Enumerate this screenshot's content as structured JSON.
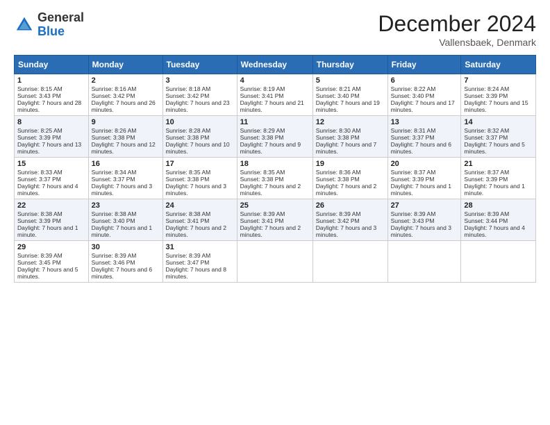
{
  "header": {
    "logo": {
      "general": "General",
      "blue": "Blue"
    },
    "title": "December 2024",
    "location": "Vallensbaek, Denmark"
  },
  "calendar": {
    "days": [
      "Sunday",
      "Monday",
      "Tuesday",
      "Wednesday",
      "Thursday",
      "Friday",
      "Saturday"
    ],
    "weeks": [
      [
        {
          "day": "1",
          "sunrise": "Sunrise: 8:15 AM",
          "sunset": "Sunset: 3:43 PM",
          "daylight": "Daylight: 7 hours and 28 minutes."
        },
        {
          "day": "2",
          "sunrise": "Sunrise: 8:16 AM",
          "sunset": "Sunset: 3:42 PM",
          "daylight": "Daylight: 7 hours and 26 minutes."
        },
        {
          "day": "3",
          "sunrise": "Sunrise: 8:18 AM",
          "sunset": "Sunset: 3:42 PM",
          "daylight": "Daylight: 7 hours and 23 minutes."
        },
        {
          "day": "4",
          "sunrise": "Sunrise: 8:19 AM",
          "sunset": "Sunset: 3:41 PM",
          "daylight": "Daylight: 7 hours and 21 minutes."
        },
        {
          "day": "5",
          "sunrise": "Sunrise: 8:21 AM",
          "sunset": "Sunset: 3:40 PM",
          "daylight": "Daylight: 7 hours and 19 minutes."
        },
        {
          "day": "6",
          "sunrise": "Sunrise: 8:22 AM",
          "sunset": "Sunset: 3:40 PM",
          "daylight": "Daylight: 7 hours and 17 minutes."
        },
        {
          "day": "7",
          "sunrise": "Sunrise: 8:24 AM",
          "sunset": "Sunset: 3:39 PM",
          "daylight": "Daylight: 7 hours and 15 minutes."
        }
      ],
      [
        {
          "day": "8",
          "sunrise": "Sunrise: 8:25 AM",
          "sunset": "Sunset: 3:39 PM",
          "daylight": "Daylight: 7 hours and 13 minutes."
        },
        {
          "day": "9",
          "sunrise": "Sunrise: 8:26 AM",
          "sunset": "Sunset: 3:38 PM",
          "daylight": "Daylight: 7 hours and 12 minutes."
        },
        {
          "day": "10",
          "sunrise": "Sunrise: 8:28 AM",
          "sunset": "Sunset: 3:38 PM",
          "daylight": "Daylight: 7 hours and 10 minutes."
        },
        {
          "day": "11",
          "sunrise": "Sunrise: 8:29 AM",
          "sunset": "Sunset: 3:38 PM",
          "daylight": "Daylight: 7 hours and 9 minutes."
        },
        {
          "day": "12",
          "sunrise": "Sunrise: 8:30 AM",
          "sunset": "Sunset: 3:38 PM",
          "daylight": "Daylight: 7 hours and 7 minutes."
        },
        {
          "day": "13",
          "sunrise": "Sunrise: 8:31 AM",
          "sunset": "Sunset: 3:37 PM",
          "daylight": "Daylight: 7 hours and 6 minutes."
        },
        {
          "day": "14",
          "sunrise": "Sunrise: 8:32 AM",
          "sunset": "Sunset: 3:37 PM",
          "daylight": "Daylight: 7 hours and 5 minutes."
        }
      ],
      [
        {
          "day": "15",
          "sunrise": "Sunrise: 8:33 AM",
          "sunset": "Sunset: 3:37 PM",
          "daylight": "Daylight: 7 hours and 4 minutes."
        },
        {
          "day": "16",
          "sunrise": "Sunrise: 8:34 AM",
          "sunset": "Sunset: 3:37 PM",
          "daylight": "Daylight: 7 hours and 3 minutes."
        },
        {
          "day": "17",
          "sunrise": "Sunrise: 8:35 AM",
          "sunset": "Sunset: 3:38 PM",
          "daylight": "Daylight: 7 hours and 3 minutes."
        },
        {
          "day": "18",
          "sunrise": "Sunrise: 8:35 AM",
          "sunset": "Sunset: 3:38 PM",
          "daylight": "Daylight: 7 hours and 2 minutes."
        },
        {
          "day": "19",
          "sunrise": "Sunrise: 8:36 AM",
          "sunset": "Sunset: 3:38 PM",
          "daylight": "Daylight: 7 hours and 2 minutes."
        },
        {
          "day": "20",
          "sunrise": "Sunrise: 8:37 AM",
          "sunset": "Sunset: 3:39 PM",
          "daylight": "Daylight: 7 hours and 1 minutes."
        },
        {
          "day": "21",
          "sunrise": "Sunrise: 8:37 AM",
          "sunset": "Sunset: 3:39 PM",
          "daylight": "Daylight: 7 hours and 1 minute."
        }
      ],
      [
        {
          "day": "22",
          "sunrise": "Sunrise: 8:38 AM",
          "sunset": "Sunset: 3:39 PM",
          "daylight": "Daylight: 7 hours and 1 minute."
        },
        {
          "day": "23",
          "sunrise": "Sunrise: 8:38 AM",
          "sunset": "Sunset: 3:40 PM",
          "daylight": "Daylight: 7 hours and 1 minute."
        },
        {
          "day": "24",
          "sunrise": "Sunrise: 8:38 AM",
          "sunset": "Sunset: 3:41 PM",
          "daylight": "Daylight: 7 hours and 2 minutes."
        },
        {
          "day": "25",
          "sunrise": "Sunrise: 8:39 AM",
          "sunset": "Sunset: 3:41 PM",
          "daylight": "Daylight: 7 hours and 2 minutes."
        },
        {
          "day": "26",
          "sunrise": "Sunrise: 8:39 AM",
          "sunset": "Sunset: 3:42 PM",
          "daylight": "Daylight: 7 hours and 3 minutes."
        },
        {
          "day": "27",
          "sunrise": "Sunrise: 8:39 AM",
          "sunset": "Sunset: 3:43 PM",
          "daylight": "Daylight: 7 hours and 3 minutes."
        },
        {
          "day": "28",
          "sunrise": "Sunrise: 8:39 AM",
          "sunset": "Sunset: 3:44 PM",
          "daylight": "Daylight: 7 hours and 4 minutes."
        }
      ],
      [
        {
          "day": "29",
          "sunrise": "Sunrise: 8:39 AM",
          "sunset": "Sunset: 3:45 PM",
          "daylight": "Daylight: 7 hours and 5 minutes."
        },
        {
          "day": "30",
          "sunrise": "Sunrise: 8:39 AM",
          "sunset": "Sunset: 3:46 PM",
          "daylight": "Daylight: 7 hours and 6 minutes."
        },
        {
          "day": "31",
          "sunrise": "Sunrise: 8:39 AM",
          "sunset": "Sunset: 3:47 PM",
          "daylight": "Daylight: 7 hours and 8 minutes."
        },
        null,
        null,
        null,
        null
      ]
    ]
  }
}
